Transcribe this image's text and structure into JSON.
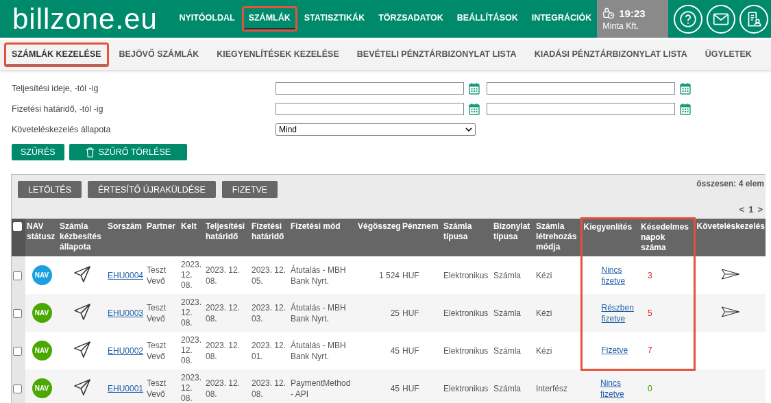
{
  "header": {
    "logo": "billzone.eu",
    "nav": [
      {
        "label": "NYITÓOLDAL",
        "selected": false,
        "highlighted": false
      },
      {
        "label": "SZÁMLÁK",
        "selected": true,
        "highlighted": true
      },
      {
        "label": "STATISZTIKÁK",
        "selected": false,
        "highlighted": false
      },
      {
        "label": "TÖRZSADATOK",
        "selected": false,
        "highlighted": false
      },
      {
        "label": "BEÁLLÍTÁSOK",
        "selected": false,
        "highlighted": false
      },
      {
        "label": "INTEGRÁCIÓK",
        "selected": false,
        "highlighted": false
      }
    ],
    "time": "19:23",
    "company": "Minta Kft."
  },
  "subnav": [
    {
      "label": "SZÁMLÁK KEZELÉSE",
      "selected": true,
      "highlighted": true
    },
    {
      "label": "BEJÖVŐ SZÁMLÁK",
      "selected": false,
      "highlighted": false
    },
    {
      "label": "KIEGYENLÍTÉSEK KEZELÉSE",
      "selected": false,
      "highlighted": false
    },
    {
      "label": "BEVÉTELI PÉNZTÁRBIZONYLAT LISTA",
      "selected": false,
      "highlighted": false
    },
    {
      "label": "KIADÁSI PÉNZTÁRBIZONYLAT LISTA",
      "selected": false,
      "highlighted": false
    },
    {
      "label": "ÜGYLETEK",
      "selected": false,
      "highlighted": false
    }
  ],
  "filters": [
    {
      "kind": "daterange",
      "label": "Teljesítési ideje, -tól -ig"
    },
    {
      "kind": "daterange",
      "label": "Fizetési határidő, -tól -ig"
    },
    {
      "kind": "select",
      "label": "Követeléskezelés állapota",
      "value": "Mind"
    }
  ],
  "filter_buttons": [
    {
      "label": "SZŰRÉS",
      "icon": false
    },
    {
      "label": "SZŰRŐ TÖRLÉSE",
      "icon": true
    }
  ],
  "toolbar": [
    "LETÖLTÉS",
    "ÉRTESÍTŐ ÚJRAKÜLDÉSE",
    "FIZETVE"
  ],
  "total": "összesen: 4 elem",
  "pagination": {
    "prev": "<",
    "page": "1",
    "next": ">"
  },
  "table": {
    "select_all_checked": false,
    "columns": [
      {
        "label": "NAV státusz",
        "highlighted": false
      },
      {
        "label": "Számla kézbesítés állapota",
        "highlighted": false
      },
      {
        "label": "Sorszám",
        "highlighted": false
      },
      {
        "label": "Partner",
        "highlighted": false
      },
      {
        "label": "Kelt",
        "highlighted": false
      },
      {
        "label": "Teljesítési határidő",
        "highlighted": false
      },
      {
        "label": "Fizetési határidő",
        "highlighted": false
      },
      {
        "label": "Fizetési mód",
        "highlighted": false
      },
      {
        "label": "Végösszeg",
        "highlighted": false
      },
      {
        "label": "Pénznem",
        "highlighted": false
      },
      {
        "label": "Számla típusa",
        "highlighted": false
      },
      {
        "label": "Bizonylat típusa",
        "highlighted": false
      },
      {
        "label": "Számla létrehozás módja",
        "highlighted": false
      },
      {
        "label": "Kiegyenlítés",
        "highlighted": true
      },
      {
        "label": "Késedelmes napok száma",
        "highlighted": true
      },
      {
        "label": "Követeléskezelés",
        "highlighted": false
      }
    ],
    "rows": [
      {
        "checked": false,
        "highlighted": true,
        "nav": "NAV",
        "color": "#1a9fe0",
        "number": "EHU0004",
        "partner": "Teszt Vevő",
        "kelt": "2023. 12. 08.",
        "teljesites": "2023. 12. 08.",
        "fizetesi": "2023. 12. 05.",
        "mod": "Átutalás - MBH Bank Nyrt.",
        "amount": "1 524",
        "currency": "HUF",
        "type": "Elektronikus",
        "doc": "Számla",
        "created": "Kézi",
        "settlement": "Nincs fizetve",
        "late": "3",
        "overdue": true,
        "collection": true
      },
      {
        "checked": false,
        "highlighted": true,
        "nav": "NAV",
        "color": "#4aa800",
        "number": "EHU0003",
        "partner": "Teszt Vevő",
        "kelt": "2023. 12. 08.",
        "teljesites": "2023. 12. 08.",
        "fizetesi": "2023. 12. 03.",
        "mod": "Átutalás - MBH Bank Nyrt.",
        "amount": "25",
        "currency": "HUF",
        "type": "Elektronikus",
        "doc": "Számla",
        "created": "Kézi",
        "settlement": "Részben fizetve",
        "late": "5",
        "overdue": true,
        "collection": true
      },
      {
        "checked": false,
        "highlighted": true,
        "nav": "NAV",
        "color": "#4aa800",
        "number": "EHU0002",
        "partner": "Teszt Vevő",
        "kelt": "2023. 12. 08.",
        "teljesites": "2023. 12. 08.",
        "fizetesi": "2023. 12. 01.",
        "mod": "Átutalás - MBH Bank Nyrt.",
        "amount": "45",
        "currency": "HUF",
        "type": "Elektronikus",
        "doc": "Számla",
        "created": "Kézi",
        "settlement": "Fizetve",
        "late": "7",
        "overdue": true,
        "collection": false
      },
      {
        "checked": false,
        "highlighted": false,
        "nav": "NAV",
        "color": "#4aa800",
        "number": "EHU0001",
        "partner": "Teszt Vevő",
        "kelt": "2023. 12. 08.",
        "teljesites": "2023. 12. 08.",
        "fizetesi": "2023. 12. 08.",
        "mod": "PaymentMethod - API",
        "amount": "45",
        "currency": "HUF",
        "type": "Elektronikus",
        "doc": "Számla",
        "created": "Interfész",
        "settlement": "Nincs fizetve",
        "late": "0",
        "overdue": false,
        "collection": false
      }
    ]
  }
}
